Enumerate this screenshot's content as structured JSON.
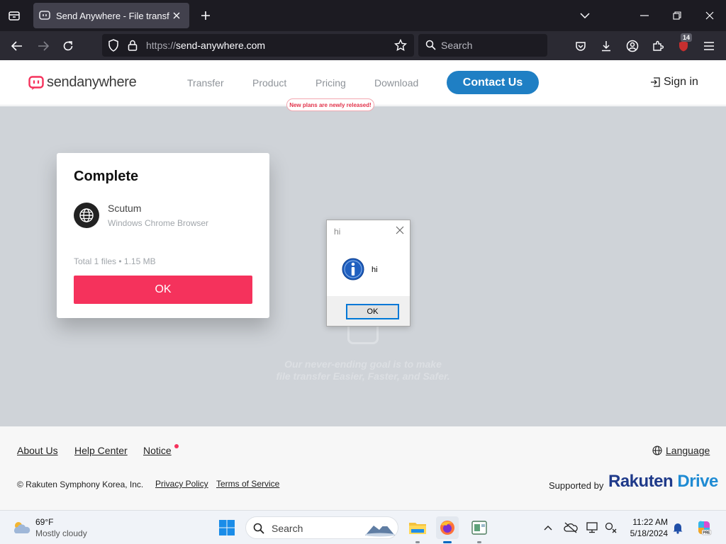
{
  "browser": {
    "tab_title": "Send Anywhere - File transfer",
    "url_protocol": "https://",
    "url_host": "send-anywhere.com",
    "search_placeholder": "Search",
    "extension_badge": "14"
  },
  "site": {
    "logo_send": "send",
    "logo_anywhere": "anywhere",
    "nav": [
      "Transfer",
      "Product",
      "Pricing",
      "Download"
    ],
    "contact_label": "Contact Us",
    "signin_label": "Sign in",
    "pricing_badge": "New plans are newly released!",
    "accent_color": "#1f7fc4",
    "brand_red": "#f5325c"
  },
  "complete_card": {
    "title": "Complete",
    "device_name": "Scutum",
    "device_type": "Windows Chrome Browser",
    "total": "Total 1 files • 1.15 MB",
    "ok_label": "OK"
  },
  "dialog": {
    "title": "hi",
    "message": "hi",
    "ok_label": "OK"
  },
  "tagline": {
    "line1": "Our never-ending goal is to make",
    "line2": "file transfer Easier, Faster, and Safer."
  },
  "footer": {
    "links": [
      "About Us",
      "Help Center",
      "Notice"
    ],
    "language_label": "Language",
    "copyright": "© Rakuten Symphony Korea, Inc.",
    "privacy": "Privacy Policy",
    "terms": "Terms of Service",
    "supported_by": "Supported by",
    "rakuten_main": "Rakuten",
    "rakuten_drive": "Drive"
  },
  "taskbar": {
    "temperature": "69°F",
    "condition": "Mostly cloudy",
    "search_placeholder": "Search",
    "time": "11:22 AM",
    "date": "5/18/2024"
  }
}
